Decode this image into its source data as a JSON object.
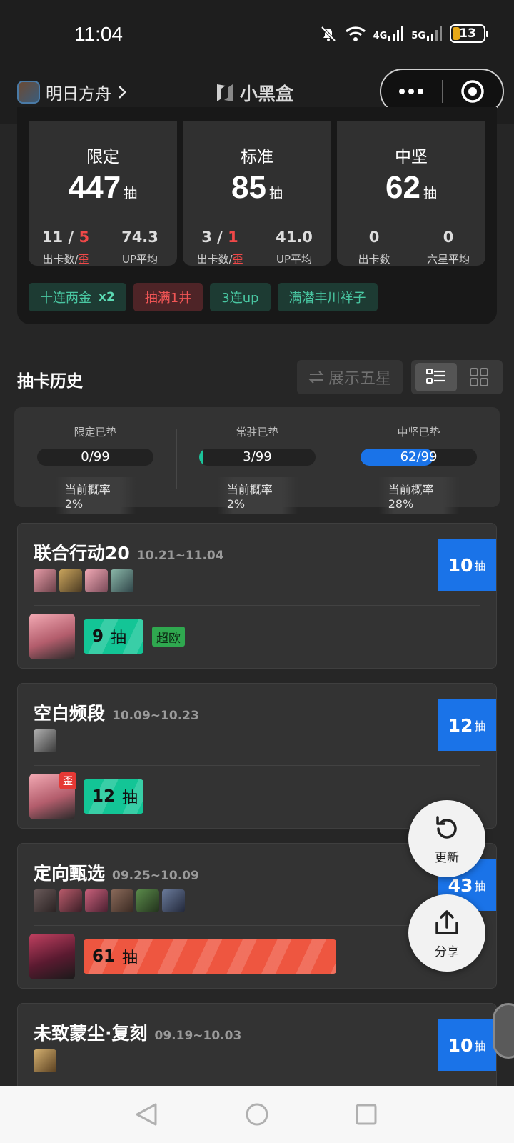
{
  "status_bar": {
    "time": "11:04",
    "network_1": "4G",
    "network_2": "5G",
    "battery": "13"
  },
  "app_bar": {
    "game_name": "明日方舟",
    "brand": "小黑盒"
  },
  "summary": {
    "cards": [
      {
        "title": "限定",
        "count": "447",
        "unit": "抽",
        "stat1_a": "11",
        "stat1_b": "5",
        "stat1_label_a": "出卡数",
        "stat1_label_b": "歪",
        "stat2": "74.3",
        "stat2_label": "UP平均"
      },
      {
        "title": "标准",
        "count": "85",
        "unit": "抽",
        "stat1_a": "3",
        "stat1_b": "1",
        "stat1_label_a": "出卡数",
        "stat1_label_b": "歪",
        "stat2": "41.0",
        "stat2_label": "UP平均"
      },
      {
        "title": "中坚",
        "count": "62",
        "unit": "抽",
        "stat1": "0",
        "stat1_label": "出卡数",
        "stat2": "0",
        "stat2_label": "六星平均"
      }
    ],
    "tags": [
      {
        "text": "十连两金",
        "extra": "x2",
        "color": "green"
      },
      {
        "text": "抽满1井",
        "color": "red"
      },
      {
        "text": "3连up",
        "color": "green"
      },
      {
        "text": "满潜丰川祥子",
        "color": "green"
      }
    ]
  },
  "history": {
    "title": "抽卡历史",
    "five_star_btn": "展示五星",
    "pity": [
      {
        "label": "限定已垫",
        "value": "0/99",
        "fill": 0,
        "rate": "当前概率2%",
        "color": "#1cc39a"
      },
      {
        "label": "常驻已垫",
        "value": "3/99",
        "fill": 0.03,
        "rate": "当前概率2%",
        "color": "#1cc39a"
      },
      {
        "label": "中坚已垫",
        "value": "62/99",
        "fill": 0.626,
        "rate": "当前概率28%",
        "color": "#1a73e8"
      }
    ],
    "banners": [
      {
        "title": "联合行动20",
        "date": "10.21~11.04",
        "count": "10",
        "unit": "抽",
        "pull": "9",
        "pull_unit": "抽",
        "pull_fill": 0.09,
        "bar": "green",
        "badge": "超欧",
        "wai": ""
      },
      {
        "title": "空白频段",
        "date": "10.09~10.23",
        "count": "12",
        "unit": "抽",
        "pull": "12",
        "pull_unit": "抽",
        "pull_fill": 0.12,
        "bar": "green",
        "badge": "",
        "wai": "歪"
      },
      {
        "title": "定向甄选",
        "date": "09.25~10.09",
        "count": "43",
        "unit": "抽",
        "pull": "61",
        "pull_unit": "抽",
        "pull_fill": 0.61,
        "bar": "red",
        "badge": "",
        "wai": ""
      },
      {
        "title": "未致蒙尘·复刻",
        "date": "09.19~10.03",
        "count": "10",
        "unit": "抽"
      }
    ]
  },
  "fab": {
    "refresh": "更新",
    "share": "分享"
  },
  "colors": {
    "accent_blue": "#1a73e8",
    "green": "#13c596",
    "red": "#ee5640",
    "bg": "#262626"
  }
}
